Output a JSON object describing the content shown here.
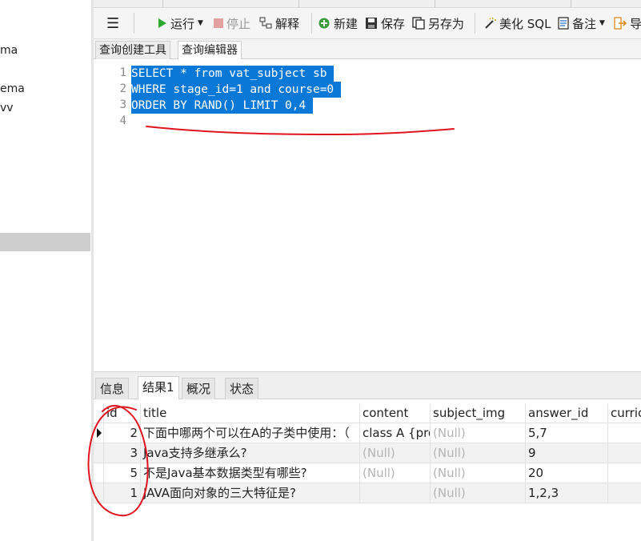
{
  "navigator": {
    "items": [
      "ma",
      "ema",
      "vv"
    ]
  },
  "toolbar": {
    "menu_label": "☰",
    "run_label": "运行",
    "stop_label": "停止",
    "explain_label": "解释",
    "new_label": "新建",
    "save_label": "保存",
    "save_as_label": "另存为",
    "beautify_label": "美化 SQL",
    "note_label": "备注",
    "export_label": "导"
  },
  "editor_tabs": [
    "查询创建工具",
    "查询编辑器"
  ],
  "editor": {
    "line_numbers": [
      "1",
      "2",
      "3",
      "4"
    ],
    "lines": [
      "SELECT * from vat_subject sb ",
      "WHERE stage_id=1 and course=0 ",
      "ORDER BY RAND() LIMIT 0,4 "
    ]
  },
  "result_tabs": [
    "信息",
    "结果1",
    "概况",
    "状态"
  ],
  "grid": {
    "columns": [
      "id",
      "title",
      "content",
      "subject_img",
      "answer_id",
      "curric"
    ],
    "rows": [
      {
        "id": "2",
        "title": "下面中哪两个可以在A的子类中使用：（",
        "content": "class A {pro",
        "subject_img": "(Null)",
        "answer_id": "5,7"
      },
      {
        "id": "3",
        "title": "Java支持多继承么?",
        "content": "(Null)",
        "subject_img": "(Null)",
        "answer_id": "9"
      },
      {
        "id": "5",
        "title": "不是Java基本数据类型有哪些?",
        "content": "(Null)",
        "subject_img": "(Null)",
        "answer_id": "20"
      },
      {
        "id": "1",
        "title": "JAVA面向对象的三大特征是?",
        "content": "",
        "subject_img": "(Null)",
        "answer_id": "1,2,3"
      }
    ]
  },
  "colors": {
    "selection": "#0a78d7",
    "annotation": "#e0141e",
    "run_green": "#2fa82f"
  }
}
